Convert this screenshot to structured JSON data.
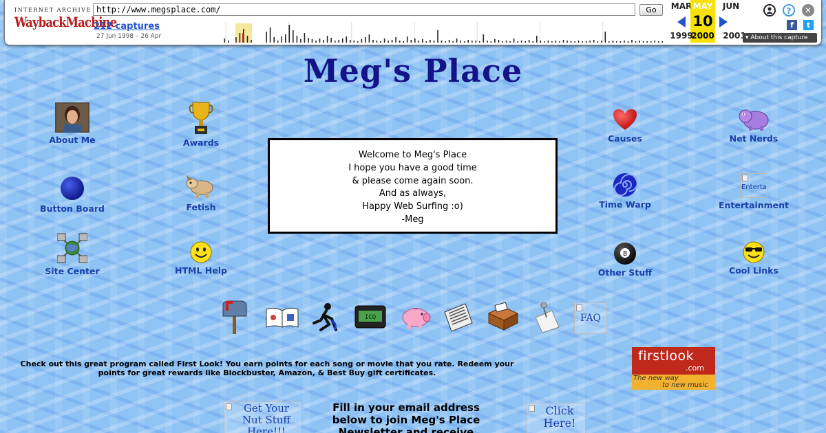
{
  "wayback": {
    "logo_top": "INTERNET ARCHIVE",
    "logo": "WaybackMachine",
    "url": "http://www.megsplace.com/",
    "go_label": "Go",
    "captures": "212 captures",
    "date_range": "27 Jun 1998 – 26 Apr",
    "prev_month": "MAR",
    "cur_month": "MAY",
    "next_month": "JUN",
    "cur_day": "10",
    "prev_year": "1999",
    "cur_year": "2000",
    "next_year": "2001",
    "about_label": "▾ About this capture",
    "fb": "f",
    "tw": "t",
    "help": "?",
    "close": "✕",
    "spark_heights": [
      0,
      0,
      0,
      0,
      0,
      0,
      0,
      0,
      0,
      0,
      0,
      0,
      0,
      0,
      0,
      0,
      6,
      3,
      0,
      8,
      14,
      20,
      10,
      4,
      0,
      0,
      0,
      16,
      22,
      8,
      3,
      9,
      12,
      26,
      18,
      10,
      5,
      14,
      7,
      5,
      3,
      6,
      4,
      10,
      7,
      3,
      4,
      6,
      9,
      4,
      3,
      2,
      5,
      8,
      12,
      4,
      3,
      2,
      6,
      3,
      4,
      8,
      3,
      2,
      9,
      4,
      6,
      3,
      5,
      2,
      4,
      3,
      18,
      3,
      2,
      4,
      2,
      6,
      3,
      2,
      4,
      3,
      3,
      2,
      12,
      3,
      2,
      5,
      4,
      2,
      3,
      2,
      6,
      2,
      3,
      2,
      4,
      2,
      10,
      3,
      2,
      3,
      2,
      3,
      2,
      4,
      3,
      2,
      2,
      3,
      2,
      2,
      3,
      4,
      2,
      3,
      16,
      2,
      3,
      2,
      2,
      3,
      2,
      4,
      2,
      3,
      2,
      2,
      2,
      3,
      2,
      2
    ]
  },
  "page": {
    "title": "Meg's Place",
    "nav_left": [
      {
        "label": "About Me",
        "icon": "portrait"
      },
      {
        "label": "Awards",
        "icon": "trophy"
      },
      {
        "label": "Button Board",
        "icon": "blue-ball"
      },
      {
        "label": "Fetish",
        "icon": "dog"
      },
      {
        "label": "Site Center",
        "icon": "network"
      },
      {
        "label": "HTML Help",
        "icon": "smiley"
      }
    ],
    "nav_right": [
      {
        "label": "Causes",
        "icon": "heart"
      },
      {
        "label": "Net Nerds",
        "icon": "purple-creature"
      },
      {
        "label": "Time Warp",
        "icon": "spiral"
      },
      {
        "label": "Entertainment",
        "icon": "broken-image",
        "alt": "Enterta"
      },
      {
        "label": "Other Stuff",
        "icon": "8-ball",
        "ball_number": "8"
      },
      {
        "label": "Cool Links",
        "icon": "cool-smiley"
      }
    ],
    "welcome": {
      "lines": [
        "Welcome to Meg's Place",
        "I hope you have a good time",
        "& please come again soon.",
        "And as always,",
        "Happy Web Surfing :o)",
        "-Meg"
      ]
    },
    "icon_row": [
      {
        "name": "mailbox-icon"
      },
      {
        "name": "guestbook-icon"
      },
      {
        "name": "aim-runner-icon"
      },
      {
        "name": "pager-icon",
        "text": "ICQ"
      },
      {
        "name": "piggy-bank-icon"
      },
      {
        "name": "newspaper-icon"
      },
      {
        "name": "inbox-tray-icon"
      },
      {
        "name": "note-pin-icon"
      },
      {
        "name": "faq-icon",
        "alt": "FAQ"
      }
    ],
    "promo": "Check out this great program called First Look!  You earn points for each song or movie that you rate.  Redeem your points for great rewards like Blockbuster, Amazon, & Best Buy gift certificates.",
    "firstlook": {
      "name": "firstlook",
      "com": ".com",
      "tag1": "The new way",
      "tag2": "to new music"
    },
    "nut_stuff_alt": "Get Your Nut Stuff Here!!!",
    "click_here_alt": "Click Here!",
    "newsletter": "Fill in your email address below to join Meg's Place Newsletter and receive updates on this site!"
  },
  "colors": {
    "title": "#141488",
    "nav_label": "#1b3fa8",
    "background": "#8fc3f4",
    "wayback_highlight": "#f6e100",
    "firstlook_red": "#c0281c"
  }
}
